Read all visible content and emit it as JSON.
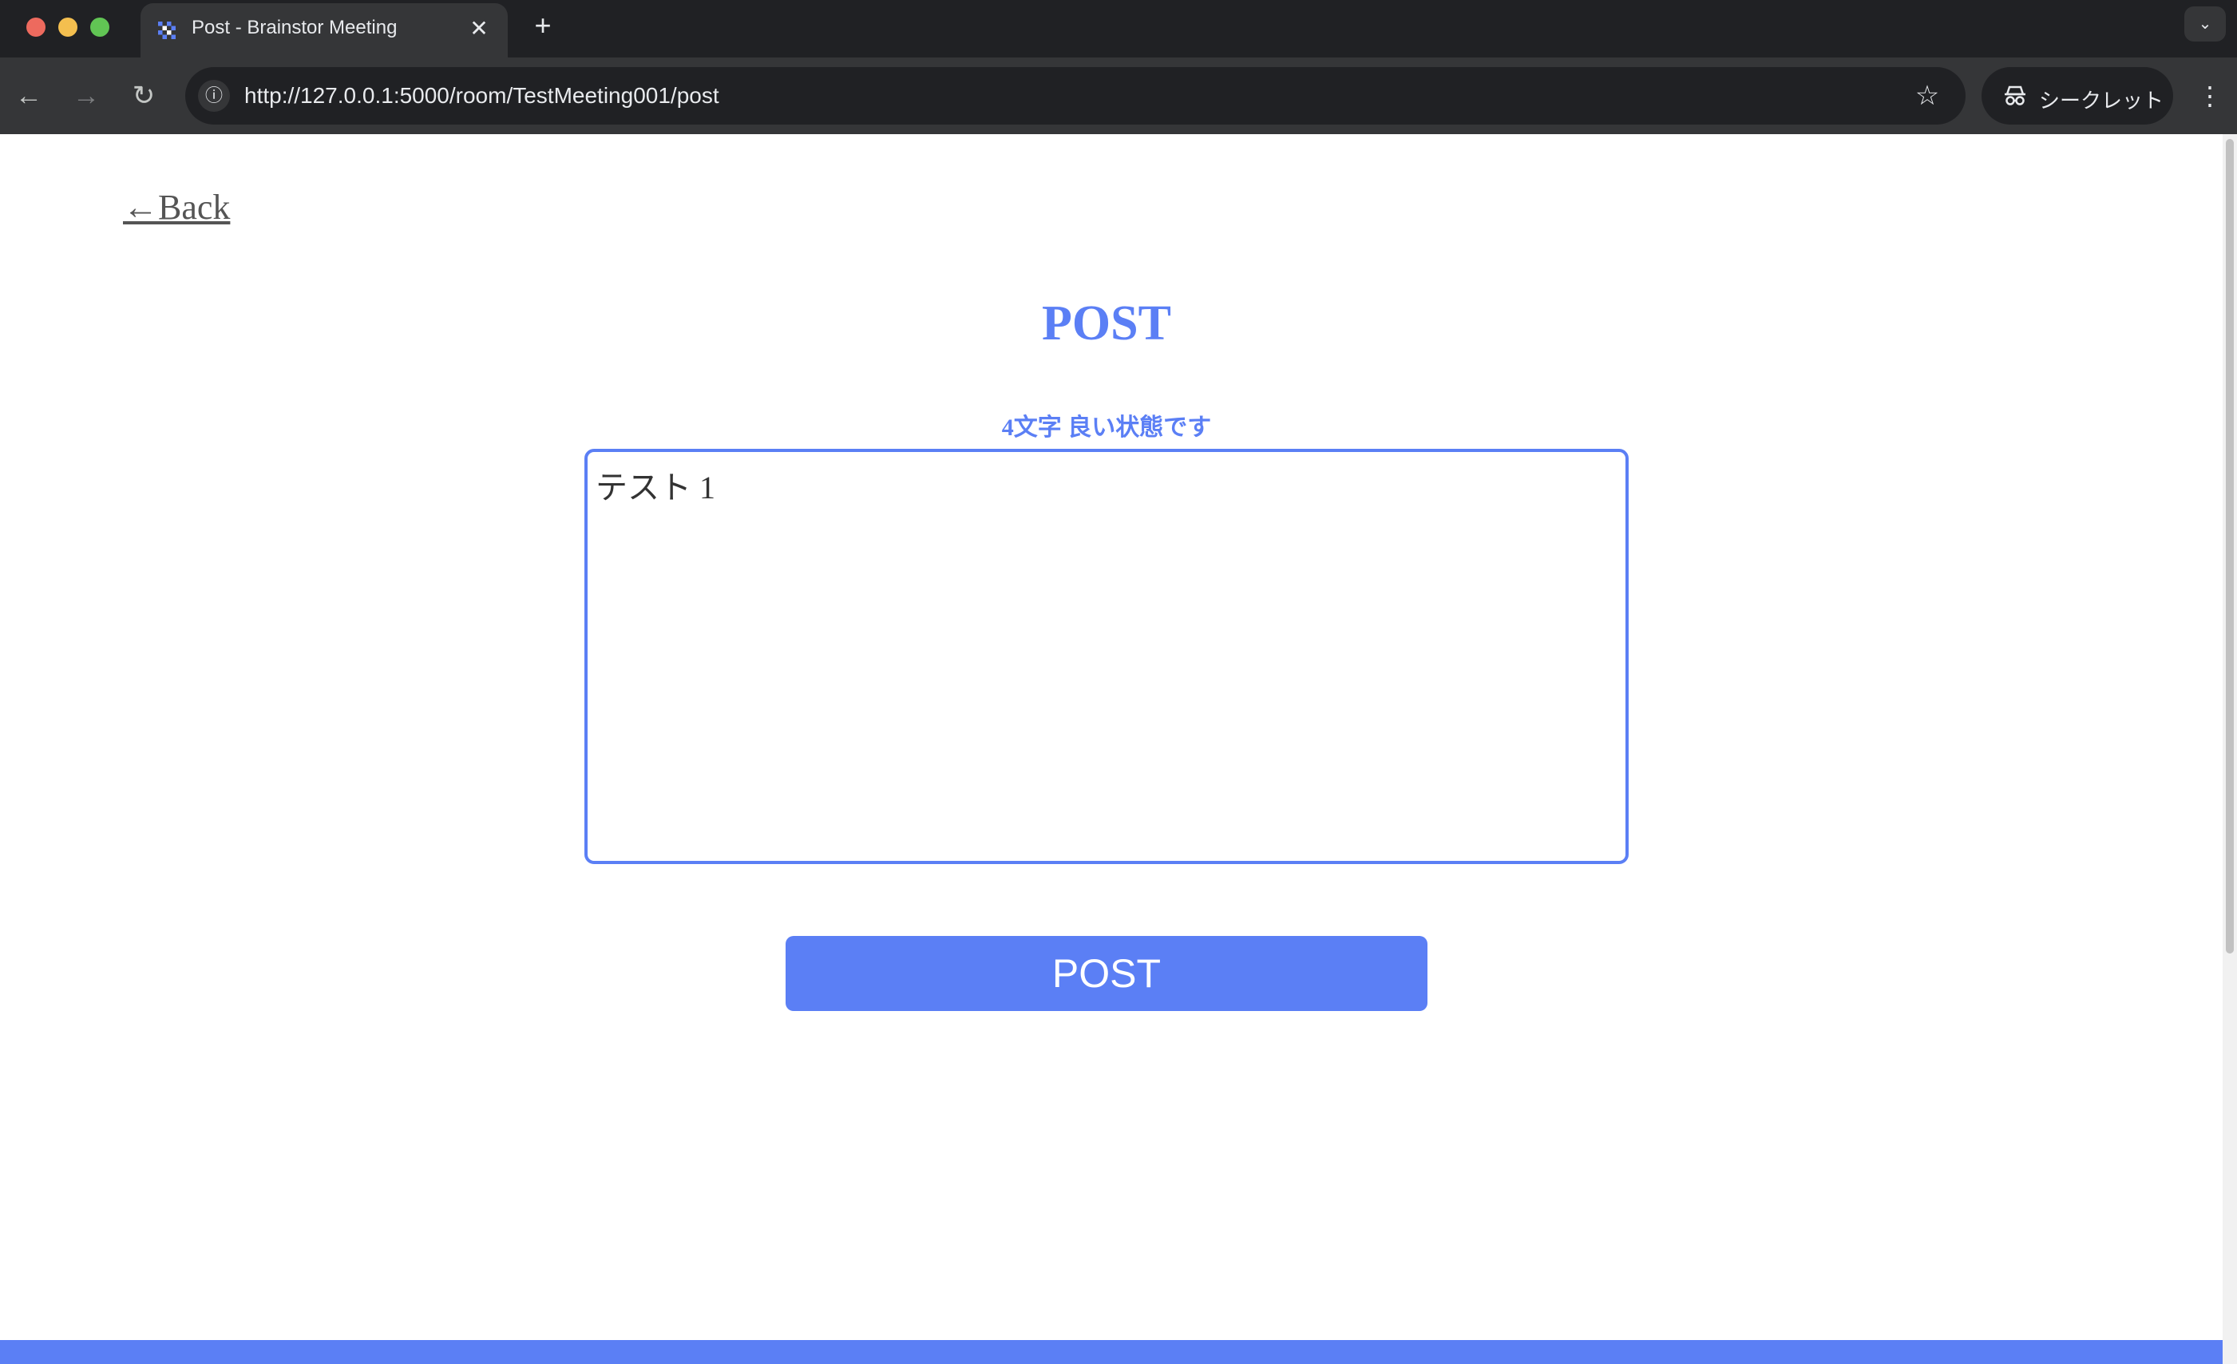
{
  "browser": {
    "tab_title": "Post - Brainstor Meeting",
    "tab_close": "✕",
    "new_tab": "+",
    "tab_menu": "⌄",
    "url": "http://127.0.0.1:5000/room/TestMeeting001/post",
    "incognito_label": "シークレット",
    "icons": {
      "back": "←",
      "forward": "→",
      "reload": "↻",
      "info": "ⓘ",
      "bookmark": "☆",
      "menu": "⋮"
    }
  },
  "page": {
    "back_link": "←Back",
    "title": "POST",
    "status": "4文字 良い状態です",
    "input_value": "テスト 1",
    "submit_label": "POST"
  },
  "colors": {
    "accent": "#5b7ff5",
    "chrome_dark": "#202124",
    "chrome_toolbar": "#353638"
  }
}
